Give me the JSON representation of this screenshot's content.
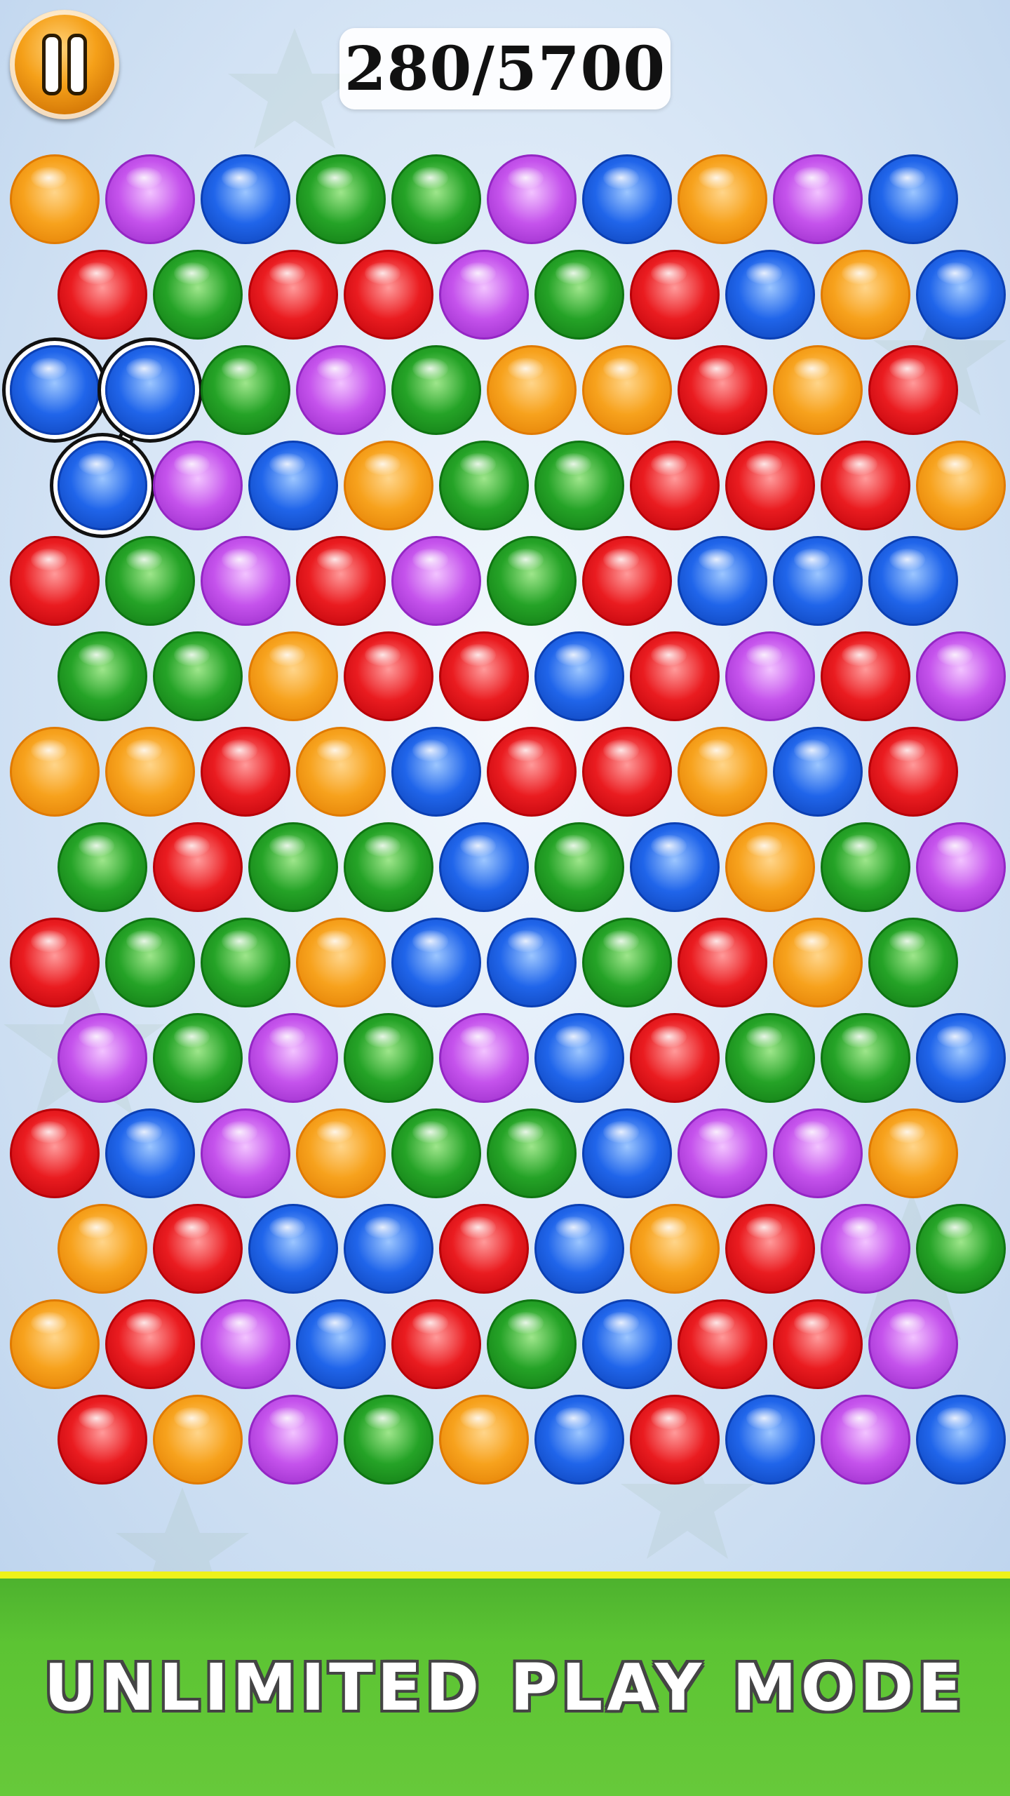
{
  "hud": {
    "score": "280/5700",
    "pause_icon": "pause-icon"
  },
  "footer": {
    "mode_label": "UNLIMITED PLAY MODE"
  },
  "colors": {
    "orange": "#f59a17",
    "purple": "#c04be6",
    "blue": "#1457e0",
    "green": "#1f9a1f",
    "red": "#e4141a",
    "accent_yellow": "#eef21a",
    "footer_green": "#5cc433"
  },
  "board": {
    "rows": [
      [
        "O",
        "P",
        "B",
        "G",
        "G",
        "P",
        "B",
        "O",
        "P",
        "B"
      ],
      [
        "R",
        "G",
        "R",
        "R",
        "P",
        "G",
        "R",
        "B",
        "O",
        "B"
      ],
      [
        "B",
        "B",
        "G",
        "P",
        "G",
        "O",
        "O",
        "R",
        "O",
        "R"
      ],
      [
        "B",
        "P",
        "B",
        "O",
        "G",
        "G",
        "R",
        "R",
        "R",
        "O"
      ],
      [
        "R",
        "G",
        "P",
        "R",
        "P",
        "G",
        "R",
        "B",
        "B",
        "B"
      ],
      [
        "G",
        "G",
        "O",
        "R",
        "R",
        "B",
        "R",
        "P",
        "R",
        "P"
      ],
      [
        "O",
        "O",
        "R",
        "O",
        "B",
        "R",
        "R",
        "O",
        "B",
        "R"
      ],
      [
        "G",
        "R",
        "G",
        "G",
        "B",
        "G",
        "B",
        "O",
        "G",
        "P"
      ],
      [
        "R",
        "G",
        "G",
        "O",
        "B",
        "B",
        "G",
        "R",
        "O",
        "G"
      ],
      [
        "P",
        "G",
        "P",
        "G",
        "P",
        "B",
        "R",
        "G",
        "G",
        "B"
      ],
      [
        "R",
        "B",
        "P",
        "O",
        "G",
        "G",
        "B",
        "P",
        "P",
        "O"
      ],
      [
        "O",
        "R",
        "B",
        "B",
        "R",
        "B",
        "O",
        "R",
        "P",
        "G"
      ],
      [
        "O",
        "R",
        "P",
        "B",
        "R",
        "G",
        "B",
        "R",
        "R",
        "P"
      ],
      [
        "R",
        "O",
        "P",
        "G",
        "O",
        "B",
        "R",
        "B",
        "P",
        "B"
      ]
    ],
    "selected_group": [
      [
        2,
        0
      ],
      [
        2,
        1
      ],
      [
        3,
        0
      ]
    ]
  }
}
